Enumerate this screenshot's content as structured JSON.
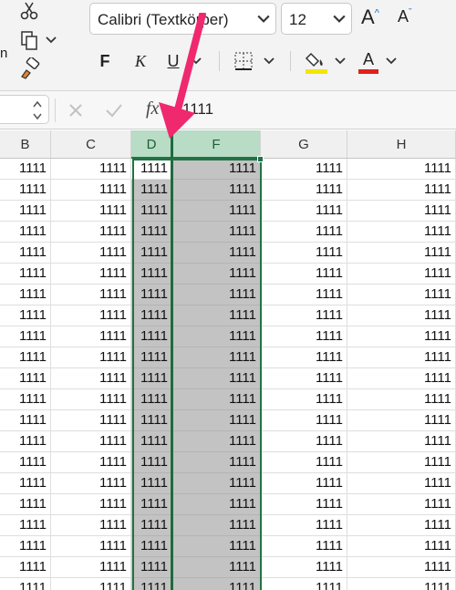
{
  "ribbon": {
    "left_label": "n",
    "font_name": "Calibri (Textkörper)",
    "font_size": "12",
    "grow_label": "A",
    "shrink_label": "A",
    "bold_label": "F",
    "italic_label": "K",
    "underline_label": "U",
    "fill_color": "#f5e600",
    "font_color": "#e0201b"
  },
  "formula_bar": {
    "fx_label": "fx",
    "value": "1111"
  },
  "columns": [
    "B",
    "C",
    "D",
    "F",
    "G",
    "H"
  ],
  "selected_columns": [
    "D",
    "F"
  ],
  "cell_value": "1111",
  "visible_rows": 21,
  "arrow_color": "#f0286e"
}
